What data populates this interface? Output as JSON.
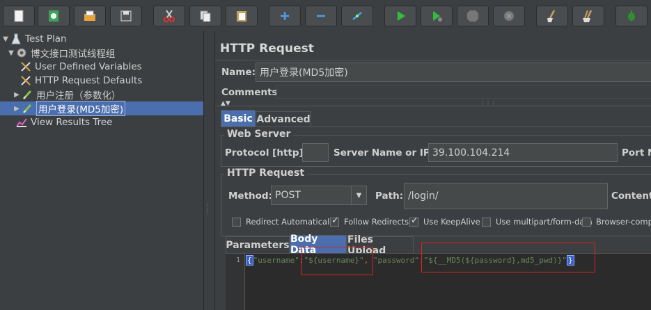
{
  "toolbar": {
    "buttons": [
      {
        "name": "new-icon"
      },
      {
        "name": "templates-icon"
      },
      {
        "name": "open-icon"
      },
      {
        "name": "save-icon"
      },
      {
        "name": "cut-icon"
      },
      {
        "name": "copy-icon"
      },
      {
        "name": "paste-icon"
      },
      {
        "name": "expand-icon"
      },
      {
        "name": "collapse-icon"
      },
      {
        "name": "toggle-icon"
      },
      {
        "name": "start-icon"
      },
      {
        "name": "start-no-pause-icon"
      },
      {
        "name": "stop-icon"
      },
      {
        "name": "shutdown-icon"
      },
      {
        "name": "clear-icon"
      },
      {
        "name": "clear-all-icon"
      },
      {
        "name": "search-icon"
      }
    ]
  },
  "tree": {
    "items": [
      {
        "label": "Test Plan",
        "icon": "test-plan-icon"
      },
      {
        "label": "博文接口测试线程组",
        "icon": "thread-group-icon"
      },
      {
        "label": "User Defined Variables",
        "icon": "config-icon"
      },
      {
        "label": "HTTP Request Defaults",
        "icon": "config-icon"
      },
      {
        "label": "用户注册（参数化）",
        "icon": "sampler-icon"
      },
      {
        "label": "用户登录(MD5加密)",
        "icon": "sampler-icon"
      },
      {
        "label": "View Results Tree",
        "icon": "listener-icon"
      }
    ]
  },
  "panel": {
    "title": "HTTP Request",
    "name_label": "Name:",
    "name_value": "用户登录(MD5加密)",
    "comments_label": "Comments:",
    "tabs": {
      "basic": "Basic",
      "advanced": "Advanced"
    },
    "web_server": {
      "title": "Web Server",
      "protocol_label": "Protocol [http]:",
      "protocol_value": "",
      "server_label": "Server Name or IP:",
      "server_value": "39.100.104.214",
      "port_label": "Port N"
    },
    "http_request": {
      "title": "HTTP Request",
      "method_label": "Method:",
      "method_value": "POST",
      "path_label": "Path:",
      "path_value": "/login/",
      "content_label": "Content"
    },
    "checkboxes": [
      {
        "label": "Redirect Automatically",
        "checked": false
      },
      {
        "label": "Follow Redirects",
        "checked": true
      },
      {
        "label": "Use KeepAlive",
        "checked": true
      },
      {
        "label": "Use multipart/form-data",
        "checked": false
      },
      {
        "label": "Browser-compa",
        "checked": false
      }
    ],
    "body_tabs": {
      "parameters": "Parameters",
      "body_data": "Body Data",
      "files_upload": "Files Upload"
    },
    "editor": {
      "line_number": "1",
      "open_brace": "{",
      "key1": "\"username\"",
      "colon1": ":",
      "val1": "\"${username}\"",
      "comma": ",",
      "key2": " \"password\"",
      "colon2": ":",
      "val2": "\"${__MD5(${password},md5_pwd)}\"",
      "close_brace": "}"
    }
  },
  "colors": {
    "accent": "#4b6eaf",
    "highlight": "#e02020",
    "string": "#6a8759"
  }
}
